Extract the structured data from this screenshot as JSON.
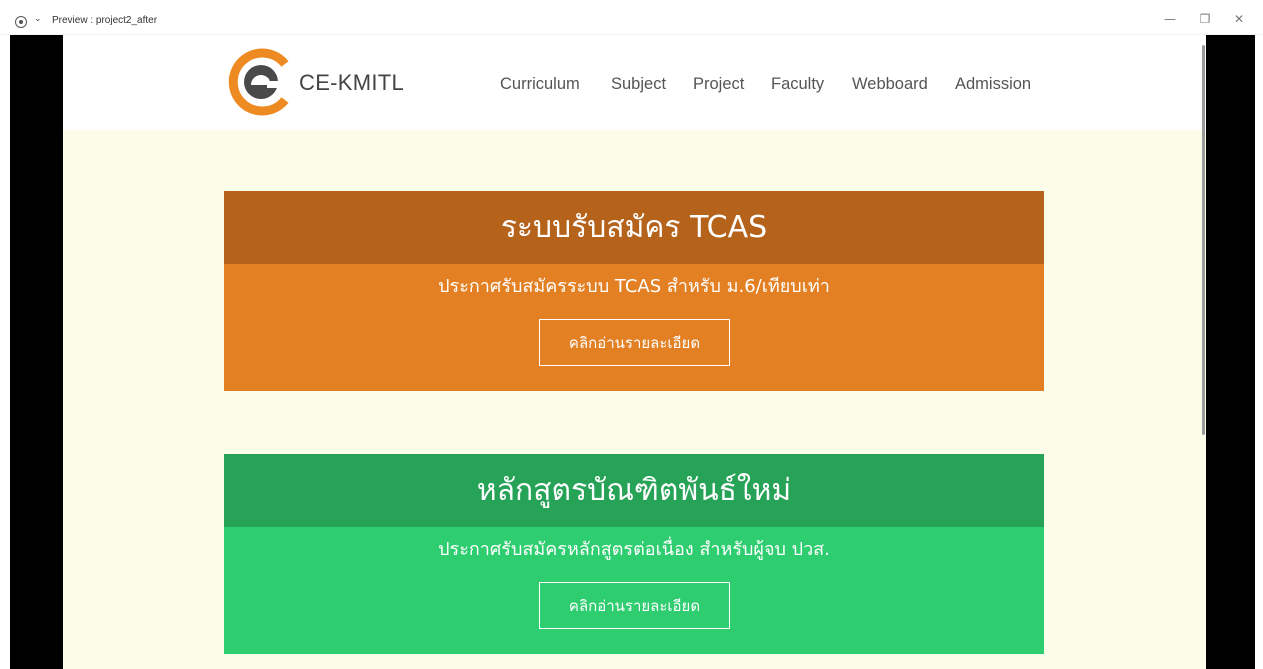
{
  "window": {
    "title": "Preview : project2_after",
    "controls": {
      "minimize": "—",
      "restore": "❐",
      "close": "✕"
    }
  },
  "navbar": {
    "brand": "CE-KMITL",
    "logo_icon": "ce-kmitl-logo",
    "items": [
      {
        "label": "Curriculum"
      },
      {
        "label": "Subject"
      },
      {
        "label": "Project"
      },
      {
        "label": "Faculty"
      },
      {
        "label": "Webboard"
      },
      {
        "label": "Admission"
      }
    ]
  },
  "cards": [
    {
      "title": "ระบบรับสมัคร TCAS",
      "subtitle": "ประกาศรับสมัครระบบ TCAS สำหรับ ม.6/เทียบเท่า",
      "button": "คลิกอ่านรายละเอียด",
      "head_color": "#b5621a",
      "body_color": "#e38024"
    },
    {
      "title": "หลักสูตรบัณฑิตพันธ์ใหม่",
      "subtitle": "ประกาศรับสมัครหลักสูตรต่อเนื่อง สำหรับผู้จบ ปวส.",
      "button": "คลิกอ่านรายละเอียด",
      "head_color": "#27a358",
      "body_color": "#2ecd70"
    }
  ],
  "colors": {
    "page_background": "#fbfde9",
    "logo_orange": "#ee8a22",
    "logo_gray": "#4a4a4a"
  }
}
